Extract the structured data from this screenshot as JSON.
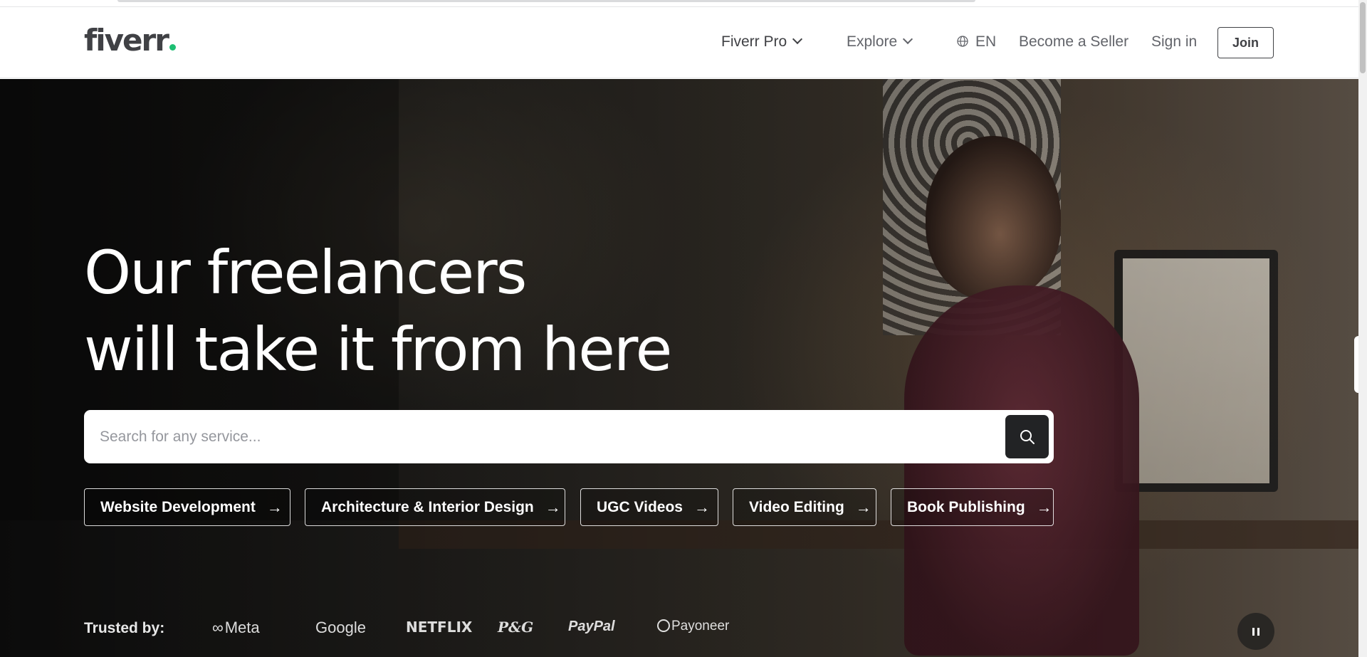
{
  "header": {
    "logo": "fiverr",
    "nav": {
      "fiverr_pro": "Fiverr Pro",
      "explore": "Explore",
      "language": "EN",
      "become_seller": "Become a Seller",
      "sign_in": "Sign in",
      "join": "Join"
    }
  },
  "hero": {
    "headline_line1": "Our freelancers",
    "headline_line2": "will take it from here",
    "search": {
      "placeholder": "Search for any service...",
      "value": ""
    },
    "chips": [
      {
        "label": "Website Development"
      },
      {
        "label": "Architecture & Interior Design"
      },
      {
        "label": "UGC Videos"
      },
      {
        "label": "Video Editing"
      },
      {
        "label": "Book Publishing"
      }
    ],
    "trusted_by": {
      "label": "Trusted by:",
      "brands": [
        "Meta",
        "Google",
        "NETFLIX",
        "P&G",
        "PayPal",
        "Payoneer"
      ]
    }
  },
  "icons": {
    "search": "search-icon",
    "globe": "globe-icon",
    "chevron": "chevron-down-icon",
    "arrow": "arrow-right-icon",
    "pause": "pause-icon"
  },
  "colors": {
    "brand_green": "#1dbf73",
    "text_dark": "#404145",
    "text_muted": "#62646a",
    "search_button": "#222325"
  }
}
